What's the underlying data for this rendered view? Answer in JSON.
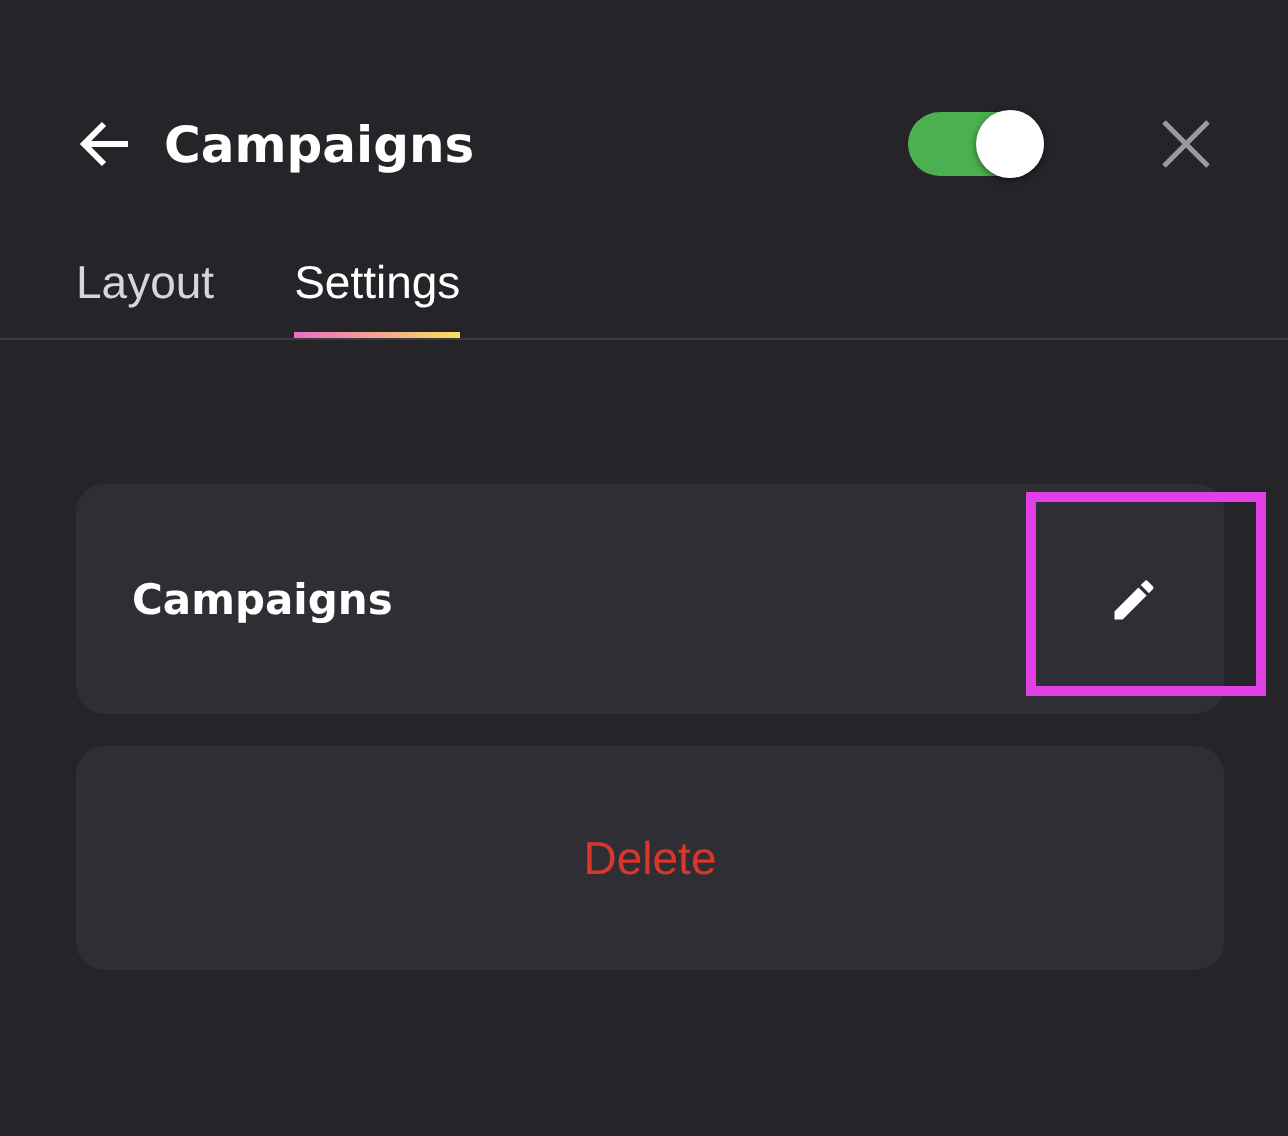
{
  "header": {
    "title": "Campaigns",
    "toggle": {
      "on": true
    }
  },
  "tabs": [
    {
      "label": "Layout",
      "selected": false
    },
    {
      "label": "Settings",
      "selected": true
    }
  ],
  "name_card": {
    "label": "Campaigns",
    "edit_highlighted": true
  },
  "delete_button": {
    "label": "Delete"
  }
}
